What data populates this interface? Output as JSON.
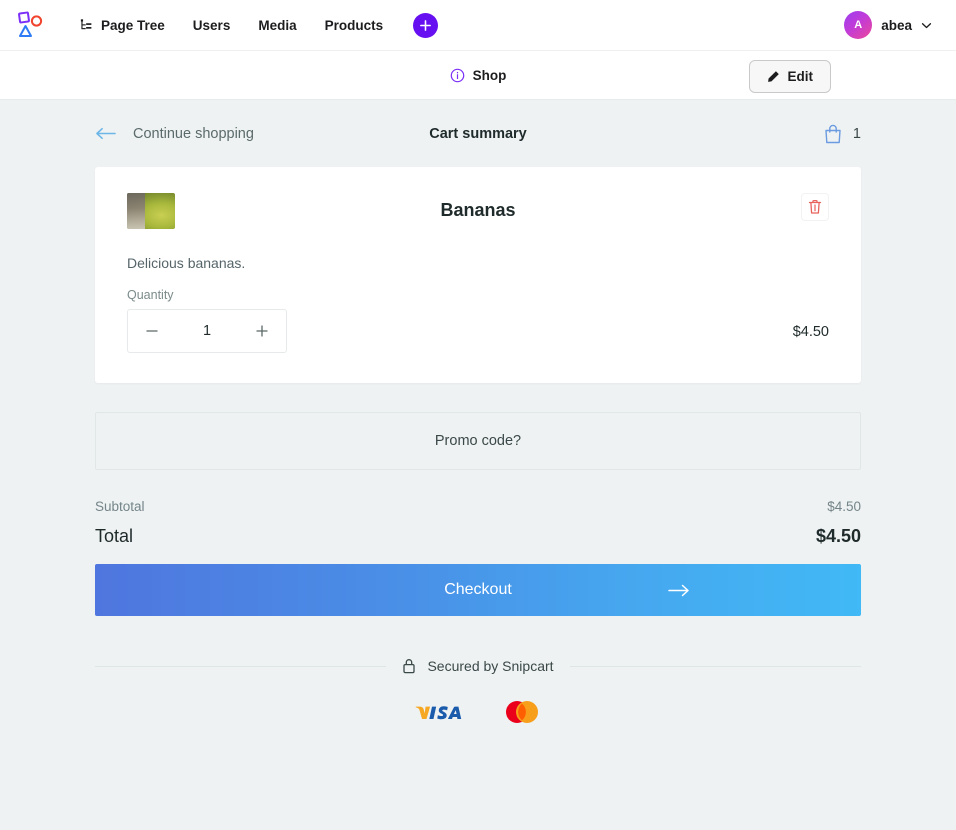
{
  "admin_bar": {
    "logo_name": "brand-logo",
    "nav": [
      {
        "label": "Page Tree",
        "icon": "tree-icon"
      },
      {
        "label": "Users",
        "icon": ""
      },
      {
        "label": "Media",
        "icon": ""
      },
      {
        "label": "Products",
        "icon": ""
      }
    ],
    "add_button_icon": "plus-icon",
    "user": {
      "initial": "A",
      "name": "abea",
      "chevron_icon": "chevron-down-icon"
    }
  },
  "shop_bar": {
    "info_icon": "info-circle-icon",
    "label": "Shop",
    "edit_label": "Edit",
    "edit_icon": "pencil-icon"
  },
  "cart": {
    "back_icon": "arrow-left-icon",
    "continue_label": "Continue shopping",
    "title": "Cart summary",
    "bag_icon": "shopping-bag-icon",
    "item_count": "1",
    "product": {
      "thumb_alt": "bananas-photo",
      "name": "Bananas",
      "description": "Delicious bananas.",
      "quantity_label": "Quantity",
      "quantity": "1",
      "minus_icon": "minus-icon",
      "plus_icon": "plus-icon",
      "price": "$4.50",
      "remove_icon": "trash-icon"
    },
    "promo_label": "Promo code?",
    "subtotal_label": "Subtotal",
    "subtotal_value": "$4.50",
    "total_label": "Total",
    "total_value": "$4.50",
    "checkout_label": "Checkout",
    "checkout_arrow_icon": "arrow-right-icon"
  },
  "footer": {
    "lock_icon": "lock-icon",
    "secured_label": "Secured by Snipcart",
    "payment_methods": [
      {
        "name": "visa-logo",
        "label": "VISA"
      },
      {
        "name": "mastercard-logo",
        "label": "Mastercard"
      }
    ]
  },
  "colors": {
    "page_bg": "#eef2f2",
    "accent_purple": "#6610f2",
    "checkout_gradient_start": "#4f76de",
    "checkout_gradient_end": "#41b9f6",
    "link_blue": "#6cb6e8",
    "danger_red": "#e8625c"
  }
}
